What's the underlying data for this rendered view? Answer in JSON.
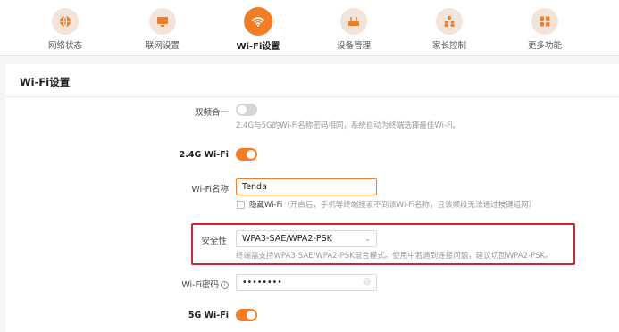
{
  "nav": {
    "items": [
      {
        "label": "网络状态",
        "icon": "globe-icon"
      },
      {
        "label": "联网设置",
        "icon": "monitor-icon"
      },
      {
        "label": "Wi-Fi设置",
        "icon": "wifi-icon"
      },
      {
        "label": "设备管理",
        "icon": "router-icon"
      },
      {
        "label": "家长控制",
        "icon": "family-icon"
      },
      {
        "label": "更多功能",
        "icon": "grid-icon"
      }
    ],
    "active_index": 2
  },
  "section": {
    "title": "Wi-Fi设置"
  },
  "dual_band": {
    "label": "双频合一",
    "enabled": false,
    "hint": "2.4G与5G的Wi-Fi名称密码相同，系统自动为终端选择最佳Wi-Fi。"
  },
  "wifi_24g": {
    "label": "2.4G Wi-Fi",
    "enabled": true
  },
  "wifi_name": {
    "label": "Wi-Fi名称",
    "value": "Tenda",
    "hide_label": "隐藏Wi-Fi",
    "hide_hint": "（开启后，手机等终端搜索不到该Wi-Fi名称，且该频段无法通过按键组网）",
    "hidden": false
  },
  "security": {
    "label": "安全性",
    "value": "WPA3-SAE/WPA2-PSK",
    "hint": "终端需支持WPA3-SAE/WPA2-PSK混合模式。使用中若遇到连接问题，建议切回WPA2-PSK。"
  },
  "wifi_password": {
    "label": "Wi-Fi密码",
    "info_glyph": "i",
    "value": "••••••••"
  },
  "wifi_5g": {
    "label": "5G Wi-Fi",
    "enabled": true
  },
  "colors": {
    "accent": "#f37d24",
    "highlight": "#d1262f"
  }
}
